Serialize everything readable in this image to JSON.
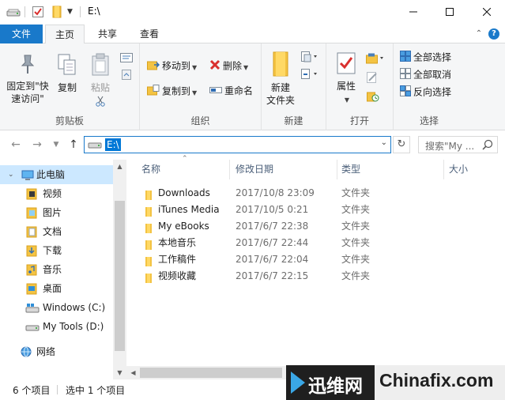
{
  "window": {
    "title": "E:\\"
  },
  "quick_access": {
    "icons": [
      "drive-icon",
      "properties-check-icon",
      "new-folder-icon",
      "customize-caret-icon"
    ]
  },
  "tabs": [
    {
      "label": "文件"
    },
    {
      "label": "主页"
    },
    {
      "label": "共享"
    },
    {
      "label": "查看"
    }
  ],
  "ribbon": {
    "clipboard": {
      "label": "剪贴板",
      "pin": "固定到\"快\n速访问\"",
      "pin_line1": "固定到\"快",
      "pin_line2": "速访问\"",
      "copy": "复制",
      "paste": "粘贴"
    },
    "organize": {
      "label": "组织",
      "move_to": "移动到",
      "copy_to": "复制到",
      "delete": "删除",
      "rename": "重命名"
    },
    "new": {
      "label": "新建",
      "new_folder_line1": "新建",
      "new_folder_line2": "文件夹"
    },
    "open": {
      "label": "打开",
      "properties": "属性"
    },
    "select": {
      "label": "选择",
      "select_all": "全部选择",
      "select_none": "全部取消",
      "invert": "反向选择"
    }
  },
  "address": {
    "path": "E:\\",
    "search_placeholder": "搜索\"My ..."
  },
  "nav": {
    "items": [
      {
        "label": "此电脑",
        "icon": "computer-icon",
        "selected": true
      },
      {
        "label": "视频",
        "icon": "videos-folder-icon"
      },
      {
        "label": "图片",
        "icon": "pictures-folder-icon"
      },
      {
        "label": "文档",
        "icon": "documents-folder-icon"
      },
      {
        "label": "下载",
        "icon": "downloads-folder-icon"
      },
      {
        "label": "音乐",
        "icon": "music-folder-icon"
      },
      {
        "label": "桌面",
        "icon": "desktop-folder-icon"
      },
      {
        "label": "Windows (C:)",
        "icon": "windows-drive-icon"
      },
      {
        "label": "My Tools (D:)",
        "icon": "drive-icon"
      },
      {
        "label": "网络",
        "icon": "network-icon"
      }
    ]
  },
  "list": {
    "columns": {
      "name": "名称",
      "date": "修改日期",
      "type": "类型",
      "size": "大小"
    },
    "rows": [
      {
        "name": "Downloads",
        "date": "2017/10/8 23:09",
        "type": "文件夹"
      },
      {
        "name": "iTunes Media",
        "date": "2017/10/5 0:21",
        "type": "文件夹"
      },
      {
        "name": "My eBooks",
        "date": "2017/6/7 22:38",
        "type": "文件夹"
      },
      {
        "name": "本地音乐",
        "date": "2017/6/7 22:44",
        "type": "文件夹"
      },
      {
        "name": "工作稿件",
        "date": "2017/6/7 22:04",
        "type": "文件夹"
      },
      {
        "name": "视频收藏",
        "date": "2017/6/7 22:15",
        "type": "文件夹"
      }
    ]
  },
  "status": {
    "item_count": "6 个项目",
    "selected": "选中 1 个项目"
  },
  "watermark": {
    "cn": "迅维网",
    "en": "Chinafix.com"
  }
}
